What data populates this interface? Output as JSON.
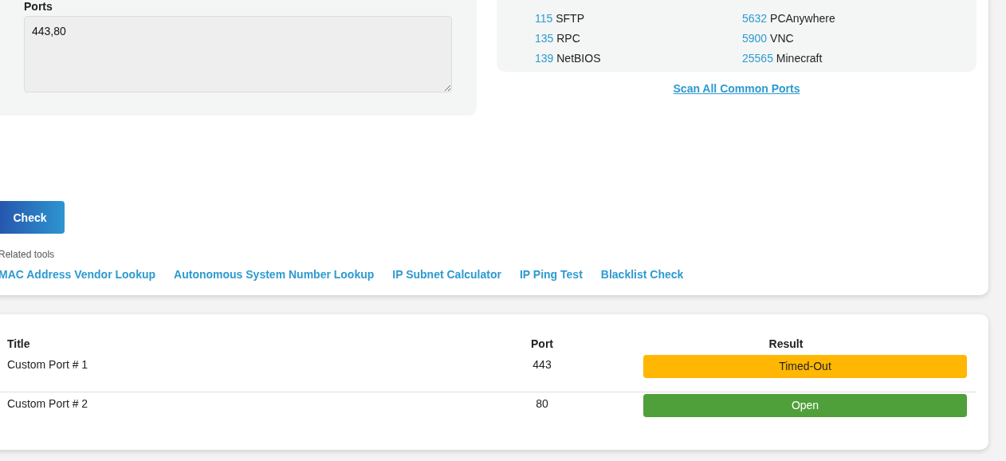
{
  "ports_field": {
    "label": "Ports",
    "value": "443,80"
  },
  "common_ports": [
    {
      "port": "115",
      "service": "SFTP"
    },
    {
      "port": "5632",
      "service": "PCAnywhere"
    },
    {
      "port": "135",
      "service": "RPC"
    },
    {
      "port": "5900",
      "service": "VNC"
    },
    {
      "port": "139",
      "service": "NetBIOS"
    },
    {
      "port": "25565",
      "service": "Minecraft"
    }
  ],
  "scan_all_link": "Scan All Common Ports",
  "check_button": "Check",
  "related_tools": {
    "label": "Related tools",
    "links": [
      "MAC Address Vendor Lookup",
      "Autonomous System Number Lookup",
      "IP Subnet Calculator",
      "IP Ping Test",
      "Blacklist Check"
    ]
  },
  "results": {
    "columns": [
      "Title",
      "Port",
      "Result"
    ],
    "rows": [
      {
        "title": "Custom Port # 1",
        "port": "443",
        "result": "Timed-Out",
        "kind": "timeout"
      },
      {
        "title": "Custom Port # 2",
        "port": "80",
        "result": "Open",
        "kind": "open"
      }
    ]
  }
}
